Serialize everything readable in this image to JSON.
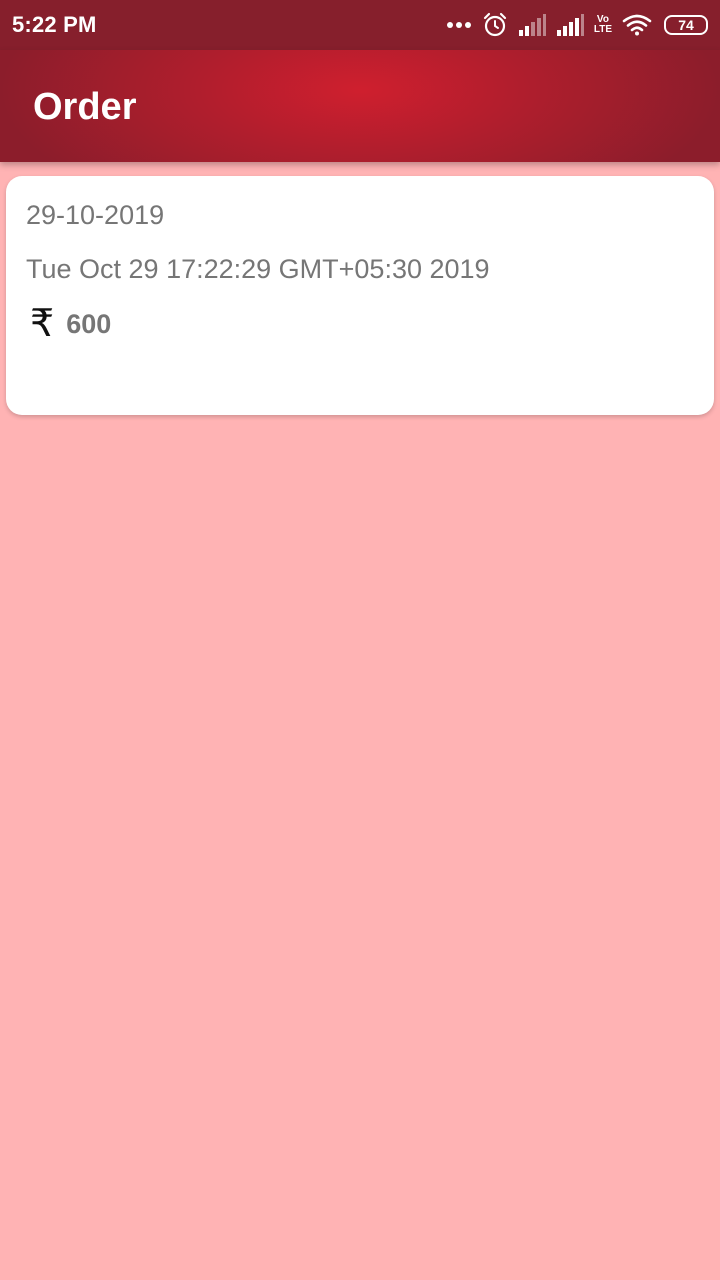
{
  "status_bar": {
    "time": "5:22 PM",
    "icons": [
      "more-dots-icon",
      "alarm-icon",
      "signal-icon",
      "signal-icon",
      "volte-icon",
      "wifi-icon",
      "battery-icon"
    ],
    "volte_top": "Vo",
    "volte_bottom": "LTE",
    "battery_level": "74"
  },
  "app_bar": {
    "title": "Order"
  },
  "orders": [
    {
      "date": "29-10-2019",
      "timestamp": "Tue Oct 29 17:22:29 GMT+05:30 2019",
      "currency_symbol": "₹",
      "amount": "600"
    }
  ],
  "colors": {
    "status_bar": "#861f2c",
    "app_bar_center": "#cf1f2e",
    "app_bar_edge": "#8c1d2b",
    "background": "#ffb3b4",
    "card": "#ffffff",
    "text_secondary": "#767676"
  }
}
